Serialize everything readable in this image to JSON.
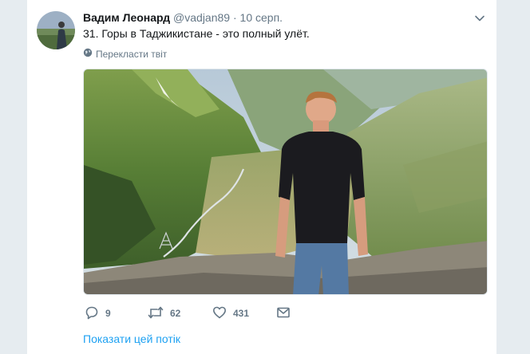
{
  "tweet": {
    "author_name": "Вадим Леонард",
    "handle": "@vadjan89",
    "separator": "·",
    "date": "10 серп.",
    "text": "31. Горы в Таджикистане - это полный улёт.",
    "translate_label": "Перекласти твіт",
    "media_icon": "photo"
  },
  "actions": {
    "reply_count": "9",
    "retweet_count": "62",
    "like_count": "431",
    "reply_icon": "reply-icon",
    "retweet_icon": "retweet-icon",
    "like_icon": "heart-icon",
    "dm_icon": "envelope-icon"
  },
  "show_thread": "Показати цей потік",
  "colors": {
    "accent": "#1da1f2",
    "secondary_text": "#657786",
    "background": "#e6ecf0"
  }
}
